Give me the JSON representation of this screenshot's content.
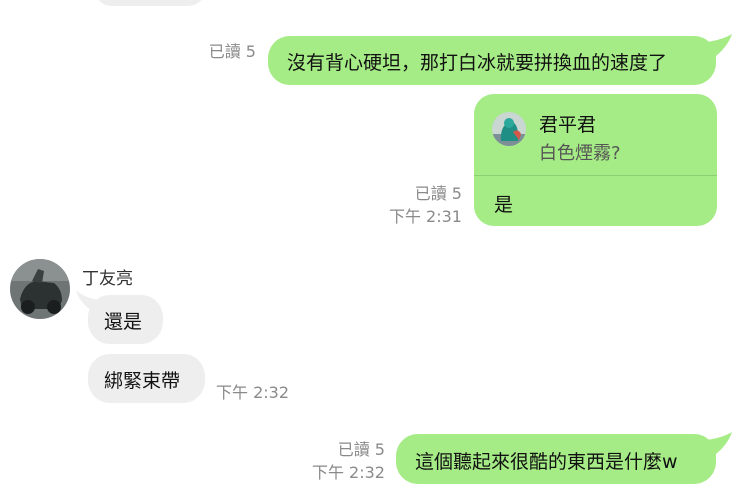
{
  "messages": {
    "m1": {
      "read": "已讀 5",
      "text": "沒有背心硬坦，那打白冰就要拼換血的速度了"
    },
    "m2": {
      "read": "已讀 5",
      "time": "下午 2:31",
      "reply_name": "君平君",
      "reply_text": "白色煙霧?",
      "text": "是"
    },
    "m3": {
      "sender": "丁友亮",
      "text": "還是"
    },
    "m4": {
      "text": "綁緊束帶",
      "time": "下午 2:32"
    },
    "m5": {
      "read": "已讀 5",
      "time": "下午 2:32",
      "text": "這個聽起來很酷的東西是什麼w"
    }
  },
  "colors": {
    "outgoing": "#a5ec86",
    "incoming": "#eeeeee",
    "meta": "#8a8a8a"
  }
}
